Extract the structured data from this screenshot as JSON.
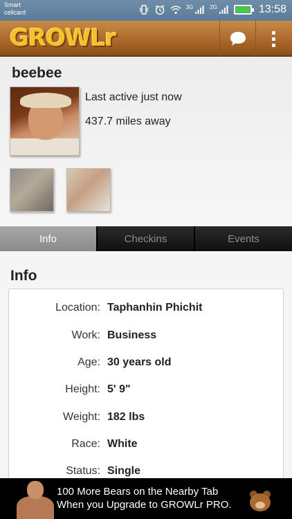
{
  "status_bar": {
    "carrier_line1": "Smart",
    "carrier_line2": "cellcard",
    "network1": "3G",
    "network2": "2G",
    "time": "13:58",
    "icons": [
      "vibrate-icon",
      "alarm-icon",
      "wifi-icon",
      "signal-icon",
      "signal-icon",
      "battery-icon"
    ]
  },
  "app_bar": {
    "logo_text": "GROWLr",
    "logo_color": "#f2c12b",
    "bar_color": "#a9662a",
    "actions": [
      "chat-icon",
      "overflow-menu-icon"
    ]
  },
  "profile": {
    "username": "beebee",
    "last_active": "Last active just now",
    "distance": "437.7 miles away"
  },
  "tabs": [
    {
      "label": "Info",
      "active": true
    },
    {
      "label": "Checkins",
      "active": false
    },
    {
      "label": "Events",
      "active": false
    }
  ],
  "info": {
    "heading": "Info",
    "rows": [
      {
        "label": "Location:",
        "value": "Taphanhin Phichit"
      },
      {
        "label": "Work:",
        "value": "Business"
      },
      {
        "label": "Age:",
        "value": "30 years old"
      },
      {
        "label": "Height:",
        "value": "5' 9\""
      },
      {
        "label": "Weight:",
        "value": "182 lbs"
      },
      {
        "label": "Race:",
        "value": "White"
      },
      {
        "label": "Status:",
        "value": "Single"
      }
    ]
  },
  "ad": {
    "line1": "100 More Bears on the Nearby Tab",
    "line2": "When you Upgrade to GROWLr PRO."
  }
}
